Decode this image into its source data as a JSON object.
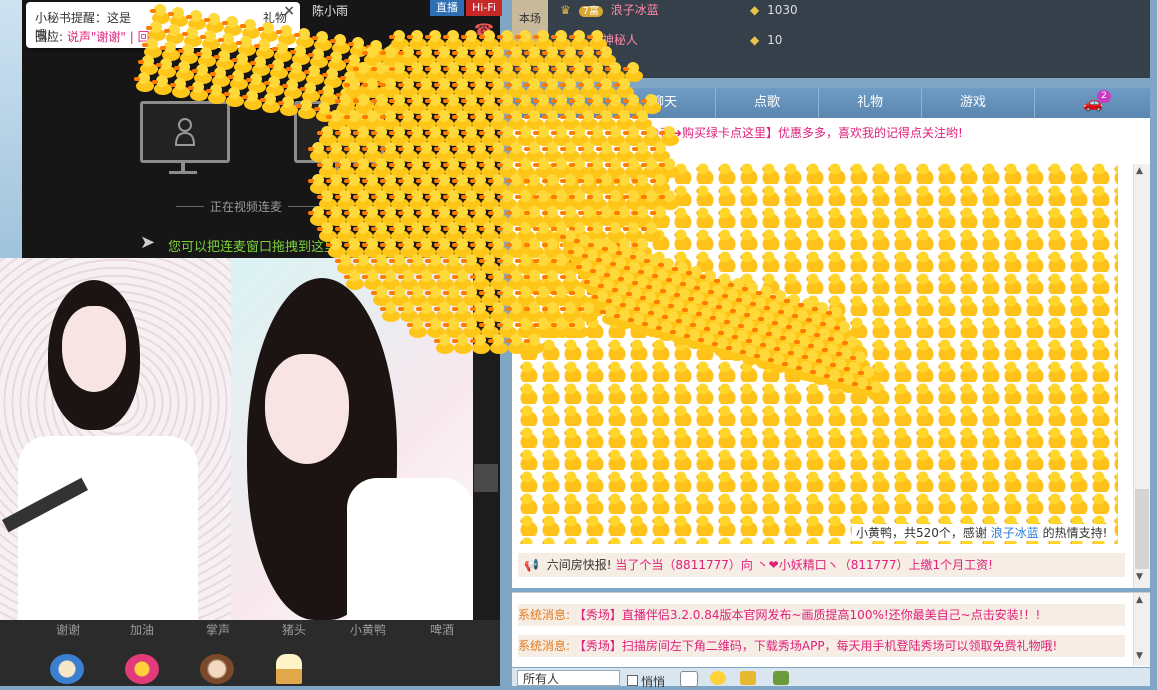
{
  "video": {
    "live_tag": "直播",
    "hifi_tag": "Hi-Fi",
    "host_name": "陈小雨",
    "hangup_label": "挂断",
    "link_status": "正在视频连麦",
    "drag_hint": "您可以把连麦窗口拖拽到这里"
  },
  "popup": {
    "line1": "小秘书提醒：这是",
    "line1_end": "礼物哦!",
    "reply_label": "回应:",
    "reply_link": "说声\"谢谢\"",
    "reply_sep": "| 回"
  },
  "gifts": [
    {
      "label": "谢谢",
      "icon": "coffee-cup-icon"
    },
    {
      "label": "加油",
      "icon": "cake-icon"
    },
    {
      "label": "掌声",
      "icon": "monkey-icon"
    },
    {
      "label": "猪头",
      "icon": "ice-cream-icon"
    },
    {
      "label": "小黄鸭",
      "icon": "duck-icon"
    },
    {
      "label": "啤酒",
      "icon": "beer-icon"
    }
  ],
  "ranking": {
    "side_label": "本场",
    "rows": [
      {
        "level": "7富",
        "name": "浪子冰蓝",
        "coins": "1030"
      },
      {
        "level": "",
        "name": "神秘人",
        "coins": "10"
      }
    ]
  },
  "tabs": [
    "聊天",
    "点歌",
    "礼物",
    "游戏"
  ],
  "car_badge": "2",
  "chat": {
    "promo": "©币➜购买绿卡点这里】优惠多多，喜欢我的记得点关注哟!",
    "gift_thanks_pre": "小黄鸭，共520个，感谢",
    "gift_thanks_name": "浪子冰蓝",
    "gift_thanks_post": "的热情支持!",
    "broadcast_pre": "六间房快报!",
    "broadcast_body": "当了个当（8811777）向 丶❤小妖精口ヽ（811777）上缴1个月工资!"
  },
  "system": [
    {
      "label": "系统消息:",
      "msg": "【秀场】直播伴侣3.2.0.84版本官网发布~画质提高100%!还你最美自己~点击安装!！!"
    },
    {
      "label": "系统消息:",
      "msg": "【秀场】扫描房间左下角二维码，下载秀场APP，每天用手机登陆秀场可以领取免费礼物哦!"
    }
  ],
  "input": {
    "recipient": "所有人",
    "whisper": "悄悄"
  },
  "colors": {
    "accent_pink": "#e0207a",
    "link_green": "#7dd13c",
    "duck_yellow": "#ffc61a",
    "tab_blue": "#6f9cc4"
  }
}
